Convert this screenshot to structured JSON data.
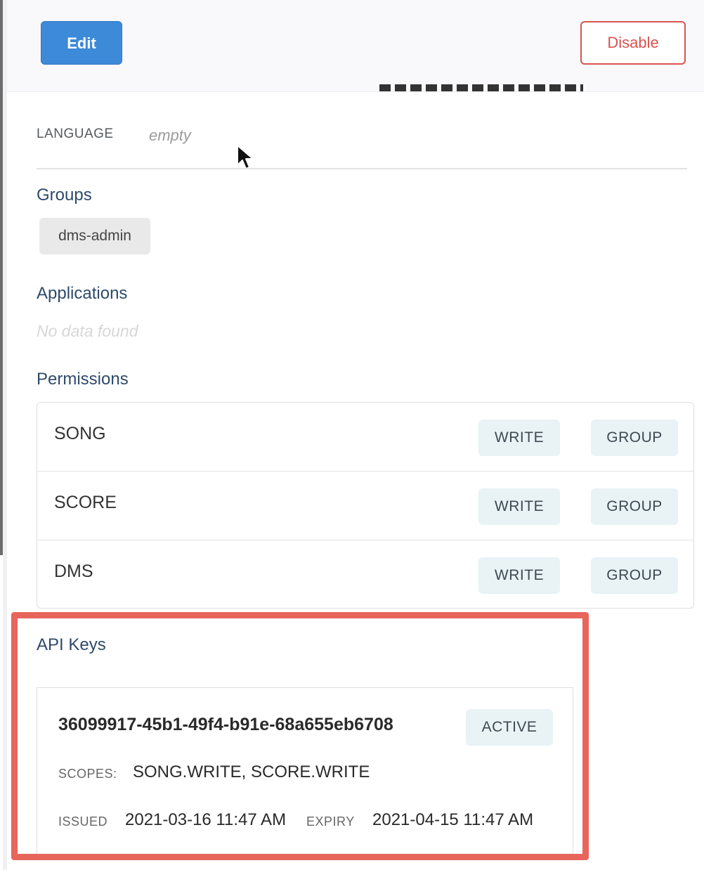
{
  "toolbar": {
    "edit_label": "Edit",
    "disable_label": "Disable"
  },
  "profile": {
    "language_label": "LANGUAGE",
    "language_value": "empty"
  },
  "groups": {
    "title": "Groups",
    "items": [
      "dms-admin"
    ]
  },
  "applications": {
    "title": "Applications",
    "empty_text": "No data found"
  },
  "permissions": {
    "title": "Permissions",
    "rows": [
      {
        "name": "SONG",
        "access": "WRITE",
        "type": "GROUP"
      },
      {
        "name": "SCORE",
        "access": "WRITE",
        "type": "GROUP"
      },
      {
        "name": "DMS",
        "access": "WRITE",
        "type": "GROUP"
      }
    ]
  },
  "api_keys": {
    "title": "API Keys",
    "keys": [
      {
        "id": "36099917-45b1-49f4-b91e-68a655eb6708",
        "status": "ACTIVE",
        "scopes_label": "SCOPES:",
        "scopes": "SONG.WRITE, SCORE.WRITE",
        "issued_label": "ISSUED",
        "issued": "2021-03-16 11:47 AM",
        "expiry_label": "EXPIRY",
        "expiry": "2021-04-15 11:47 AM"
      }
    ]
  },
  "colors": {
    "primary": "#3d8ad8",
    "danger": "#d9534f",
    "highlight": "#e7655b",
    "chip_bg": "#e9f2f5",
    "section_title": "#2f4a6a"
  }
}
